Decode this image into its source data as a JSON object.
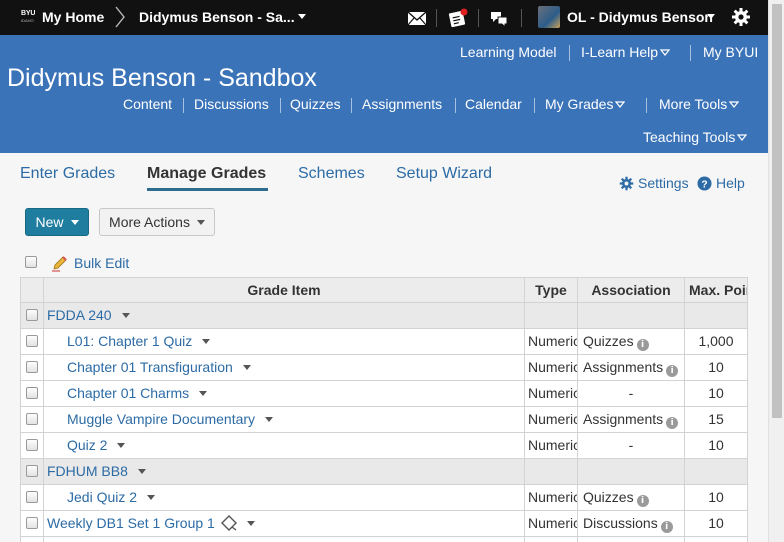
{
  "topbar": {
    "logo_text": "BYU",
    "logo_sub": "IDAHO",
    "home_label": "My Home",
    "course_label": "Didymus Benson - Sa...",
    "user_label": "OL - Didymus Benson",
    "icons": [
      "email-icon",
      "updates-icon",
      "messages-icon",
      "gear-icon"
    ]
  },
  "header": {
    "title": "Didymus Benson - Sandbox",
    "util_links": [
      "Learning Model",
      "I-Learn Help",
      "My BYUI"
    ],
    "nav": [
      "Content",
      "Discussions",
      "Quizzes",
      "Assignments",
      "Calendar",
      "My Grades",
      "More Tools",
      "Teaching Tools"
    ],
    "color": "#3b73b9"
  },
  "tabs": {
    "items": [
      "Enter Grades",
      "Manage Grades",
      "Schemes",
      "Setup Wizard"
    ],
    "active": "Manage Grades",
    "settings_label": "Settings",
    "help_label": "Help"
  },
  "actions": {
    "new_label": "New",
    "more_label": "More Actions",
    "bulk_edit_label": "Bulk Edit"
  },
  "table": {
    "columns": [
      "Grade Item",
      "Type",
      "Association",
      "Max. Points"
    ],
    "rows": [
      {
        "kind": "category",
        "name": "FDDA 240"
      },
      {
        "kind": "item",
        "name": "L01: Chapter 1 Quiz",
        "type": "Numeric",
        "association": "Quizzes",
        "points": "1,000"
      },
      {
        "kind": "item",
        "name": "Chapter 01 Transfiguration",
        "type": "Numeric",
        "association": "Assignments",
        "points": "10"
      },
      {
        "kind": "item",
        "name": "Chapter 01 Charms",
        "type": "Numeric",
        "association": "-",
        "points": "10"
      },
      {
        "kind": "item",
        "name": "Muggle Vampire Documentary",
        "type": "Numeric",
        "association": "Assignments",
        "points": "15"
      },
      {
        "kind": "item",
        "name": "Quiz 2",
        "type": "Numeric",
        "association": "-",
        "points": "10"
      },
      {
        "kind": "category",
        "name": "FDHUM BB8"
      },
      {
        "kind": "item",
        "name": "Jedi Quiz 2",
        "type": "Numeric",
        "association": "Quizzes",
        "points": "10"
      },
      {
        "kind": "item-top",
        "name": "Weekly DB1 Set 1 Group 1",
        "type": "Numeric",
        "association": "Discussions",
        "points": "10",
        "diamond": true
      }
    ]
  }
}
